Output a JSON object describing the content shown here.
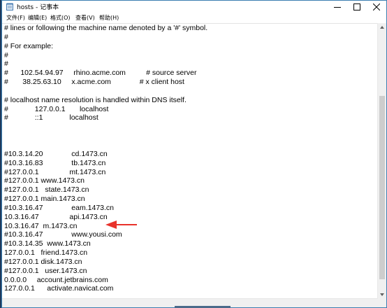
{
  "window": {
    "title": "hosts - 记事本"
  },
  "menu": [
    {
      "label": "文件(F)"
    },
    {
      "label": "编辑(E)"
    },
    {
      "label": "格式(O)"
    },
    {
      "label": "查看(V)"
    },
    {
      "label": "帮助(H)"
    }
  ],
  "editor": {
    "lines": [
      "# lines or following the machine name denoted by a '#' symbol.",
      "#",
      "# For example:",
      "#",
      "#",
      "#      102.54.94.97     rhino.acme.com          # source server",
      "#       38.25.63.10     x.acme.com              # x client host",
      "",
      "# localhost name resolution is handled within DNS itself.",
      "#             127.0.0.1       localhost",
      "#             ::1             localhost",
      "",
      "",
      "",
      "#10.3.14.20              cd.1473.cn",
      "#10.3.16.83              tb.1473.cn",
      "#127.0.0.1               mt.1473.cn",
      "#127.0.0.1 www.1473.cn",
      "#127.0.0.1   state.1473.cn",
      "#127.0.0.1 main.1473.cn",
      "#10.3.16.47              eam.1473.cn",
      "10.3.16.47               api.1473.cn",
      "10.3.16.47  m.1473.cn",
      "#10.3.16.47              www.yousi.com",
      "#10.3.14.35  www.1473.cn",
      "127.0.0.1   friend.1473.cn",
      "#127.0.0.1 disk.1473.cn",
      "#127.0.0.1   user.1473.cn",
      "0.0.0.0     account.jetbrains.com",
      "127.0.0.1      activate.navicat.com"
    ]
  },
  "annotation": {
    "arrow_color": "#e8322b"
  }
}
